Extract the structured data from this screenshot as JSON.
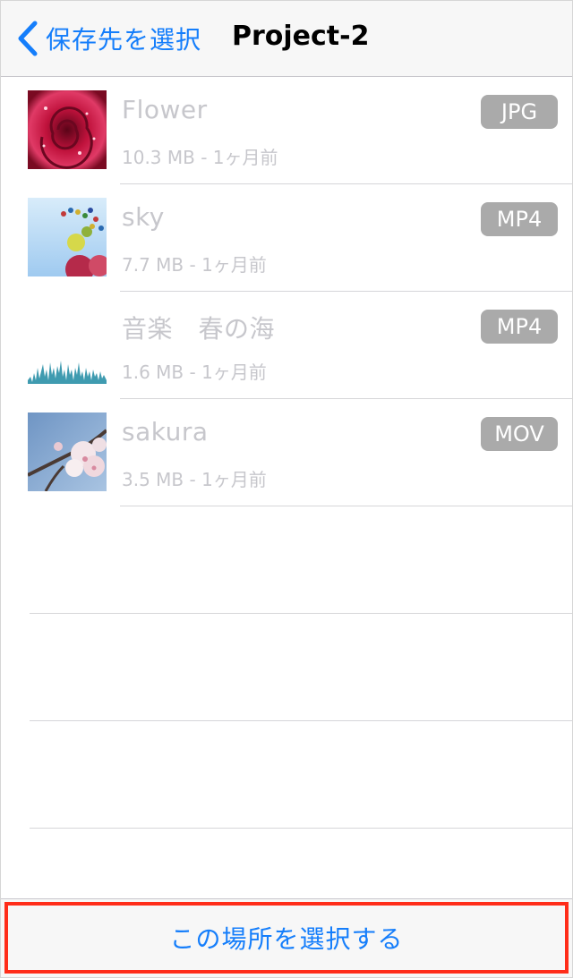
{
  "navbar": {
    "back_label": "保存先を選択",
    "title": "Project-2"
  },
  "files": [
    {
      "name": "Flower",
      "meta": "10.3 MB - 1ヶ月前",
      "type": "JPG",
      "thumbnail": "rose-photo"
    },
    {
      "name": "sky",
      "meta": "7.7 MB - 1ヶ月前",
      "type": "MP4",
      "thumbnail": "balloons-sky-photo"
    },
    {
      "name": "音楽　春の海",
      "meta": "1.6 MB - 1ヶ月前",
      "type": "MP4",
      "thumbnail": "audio-waveform"
    },
    {
      "name": "sakura",
      "meta": "3.5 MB - 1ヶ月前",
      "type": "MOV",
      "thumbnail": "cherry-blossom-photo"
    }
  ],
  "toolbar": {
    "select_label": "この場所を選択する"
  },
  "colors": {
    "accent": "#157efb",
    "highlight_border": "#ff2d1a",
    "badge": "#aaaaaa",
    "disabled_text": "#c7c7cc"
  }
}
